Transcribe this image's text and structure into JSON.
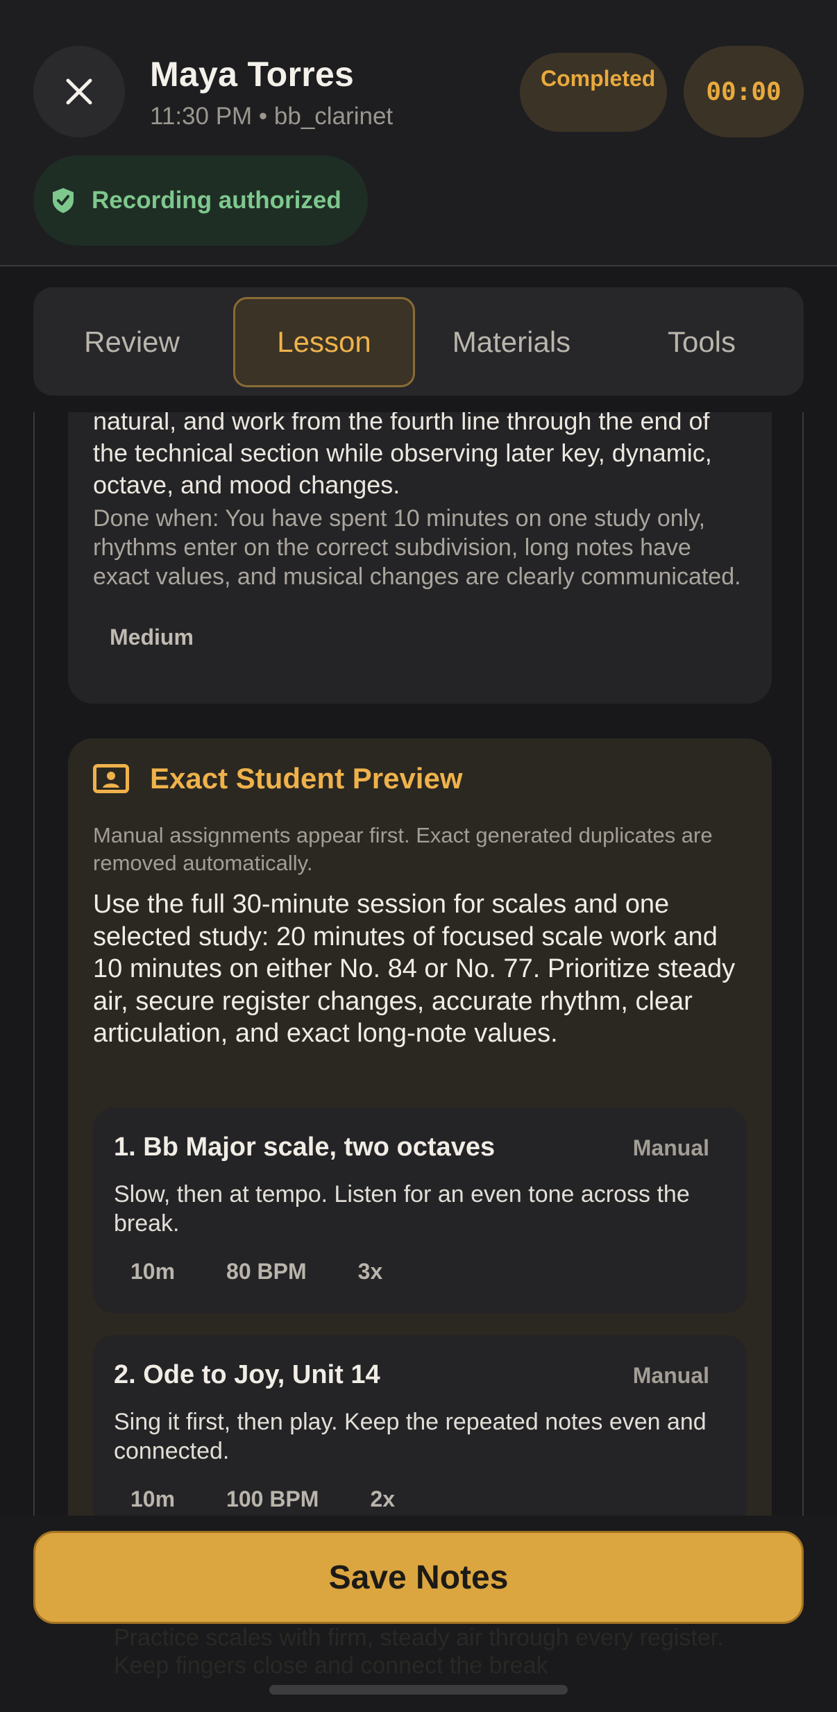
{
  "header": {
    "name": "Maya Torres",
    "subtitle": "11:30 PM • bb_clarinet",
    "status": "Completed",
    "timer": "00:00",
    "recording": "Recording authorized"
  },
  "tabs": [
    {
      "label": "Review",
      "active": false
    },
    {
      "label": "Lesson",
      "active": true
    },
    {
      "label": "Materials",
      "active": false
    },
    {
      "label": "Tools",
      "active": false
    }
  ],
  "prev_card": {
    "body": "natural, and work from the fourth line through the end of the technical section while observing later key, dynamic, octave, and mood changes.",
    "done_when": "Done when: You have spent 10 minutes on one study only, rhythms enter on the correct subdivision, long notes have exact values, and musical changes are clearly communicated.",
    "difficulty": "Medium"
  },
  "preview": {
    "title": "Exact Student Preview",
    "note": "Manual assignments appear first. Exact generated duplicates are removed automatically.",
    "summary": "Use the full 30-minute session for scales and one selected study: 20 minutes of focused scale work and 10 minutes on either No. 84 or No. 77. Prioritize steady air, secure register changes, accurate rhythm, clear articulation, and exact long-note values.",
    "assignments": [
      {
        "title": "1. Bb Major scale, two octaves",
        "source": "Manual",
        "desc": "Slow, then at tempo. Listen for an even tone across the break.",
        "duration": "10m",
        "tempo": "80 BPM",
        "reps": "3x"
      },
      {
        "title": "2. Ode to Joy, Unit 14",
        "source": "Manual",
        "desc": "Sing it first, then play. Keep the repeated notes even and connected.",
        "duration": "10m",
        "tempo": "100 BPM",
        "reps": "2x"
      }
    ]
  },
  "save_label": "Save Notes",
  "behind_text": "Practice scales with firm, steady air through every register. Keep fingers close and connect the break"
}
